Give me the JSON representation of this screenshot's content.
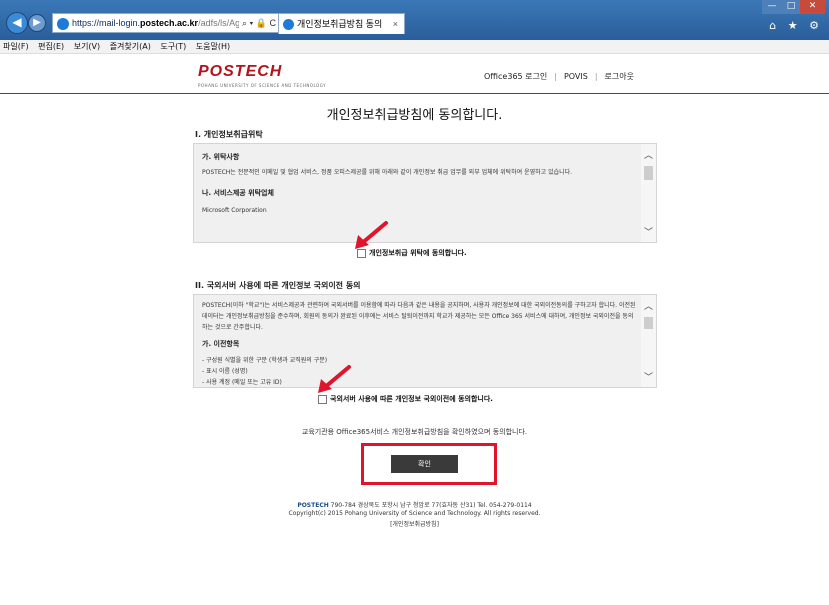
{
  "browser": {
    "url_part1": "https://mail-login.",
    "url_domain": "postech.ac.kr",
    "url_part3": "/adfs/ls/AgreePri",
    "url_controls": "⌕ ▾ 🔒 C",
    "tab_title": "개인정보취급방침 동의",
    "tab_close": "×",
    "window_min": "—",
    "window_max": "□",
    "window_close": "✕",
    "right_icons": "⌂ ★ ⚙"
  },
  "menu": [
    "파일(F)",
    "편집(E)",
    "보기(V)",
    "즐겨찾기(A)",
    "도구(T)",
    "도움말(H)"
  ],
  "header": {
    "logo": "POSTECH",
    "logo_sub": "POHANG UNIVERSITY OF SCIENCE AND TECHNOLOGY",
    "link_office": "Office365 로그인",
    "link_povis": "POVIS",
    "link_logout": "로그아웃",
    "separator": "|"
  },
  "page_title": "개인정보취급방침에 동의합니다.",
  "section1": {
    "heading": "I. 개인정보취급위탁",
    "sub1_title": "가. 위탁사항",
    "sub1_body": "POSTECH는 전문적인 이메일 및 협업 서비스, 정품 오피스제공를 위해 아래와 같이 개인정보 취급 업무를 외부 업체에 위탁하여 운영하고 있습니다.",
    "sub2_title": "나. 서비스제공 위탁업체",
    "sub2_body": "Microsoft Corporation",
    "checkbox_label": "개인정보취급 위탁에 동의합니다."
  },
  "section2": {
    "heading": "II. 국외서버 사용에 따른 개인정보 국외이전 동의",
    "body": "POSTECH(이하 \"학교\")는 서비스제공과 관련하여 국외서버를 이용함에 따라 다음과 같은 내용을 공지하며, 사용자 개인정보에 대한 국외이전동의를 구하고자 합니다. 이전된 데이터는 개인정보취급방침을 준수하며, 회원의 동의가 완료된 이후에는 서비스 탈퇴이전까지 학교가 제공하는 모든 Office 365 서비스에 대하여, 개인정보 국외이전을 동의하는 것으로 간주합니다.",
    "sub_title": "가. 이전항목",
    "item1": "- 구성원 식별을 위한 구분 (학생과 교직원의 구분)",
    "item2": "- 표시 이름 (성명)",
    "item3": "- 사용 계정 (메일 또는 고유 ID)",
    "checkbox_label": "국외서버 사용에 따른 개인정보 국외이전에 동의합니다."
  },
  "confirm": {
    "note": "교육기관용 Office365서비스 개인정보취급방침을 확인하였으며 동의합니다.",
    "button": "확인"
  },
  "footer": {
    "org": "POSTECH",
    "address": " 790-784 경상북도 포항시 남구 청암로 77(효자동 산31) Tel. 054-279-0114",
    "copyright": "Copyright(c) 2015 Pohang University of Science and Technology. All rights reserved.",
    "privacy_link": "[개인정보취급방침]"
  },
  "colors": {
    "brand_red": "#c8102e",
    "highlight_red": "#e0142b",
    "button_dark": "#3a3a3a",
    "chrome_blue": "#2a5e99"
  }
}
